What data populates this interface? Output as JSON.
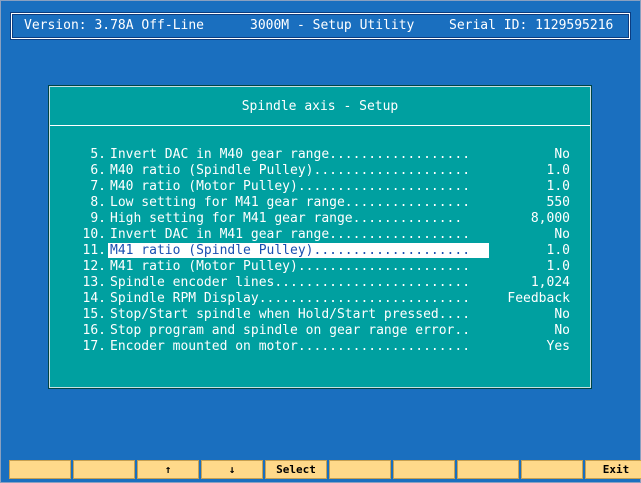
{
  "header": {
    "version": "Version: 3.78A Off-Line",
    "title": "3000M - Setup Utility",
    "serial": "Serial ID: 1129595216"
  },
  "dialog": {
    "title": "Spindle axis - Setup",
    "rows": [
      {
        "num": "5.",
        "label": "Invert DAC in M40 gear range..................",
        "value": "No"
      },
      {
        "num": "6.",
        "label": "M40 ratio (Spindle Pulley)....................",
        "value": "1.0"
      },
      {
        "num": "7.",
        "label": "M40 ratio (Motor Pulley)......................",
        "value": "1.0"
      },
      {
        "num": "8.",
        "label": "Low setting for M41 gear range................",
        "value": "550"
      },
      {
        "num": "9.",
        "label": "High setting for M41 gear range..............",
        "value": "8,000"
      },
      {
        "num": "10.",
        "label": "Invert DAC in M41 gear range..................",
        "value": "No"
      },
      {
        "num": "11.",
        "label": "M41 ratio (Spindle Pulley)....................",
        "value": "1.0"
      },
      {
        "num": "12.",
        "label": "M41 ratio (Motor Pulley)......................",
        "value": "1.0"
      },
      {
        "num": "13.",
        "label": "Spindle encoder lines.........................",
        "value": "1,024"
      },
      {
        "num": "14.",
        "label": "Spindle RPM Display...........................",
        "value": "Feedback"
      },
      {
        "num": "15.",
        "label": "Stop/Start spindle when Hold/Start pressed....",
        "value": "No"
      },
      {
        "num": "16.",
        "label": "Stop program and spindle on gear range error..",
        "value": "No"
      },
      {
        "num": "17.",
        "label": "Encoder mounted on motor......................",
        "value": "Yes"
      }
    ],
    "selected_index": 6
  },
  "fkeys": [
    "",
    "",
    "↑",
    "↓",
    "Select",
    "",
    "",
    "",
    "",
    "Exit"
  ]
}
